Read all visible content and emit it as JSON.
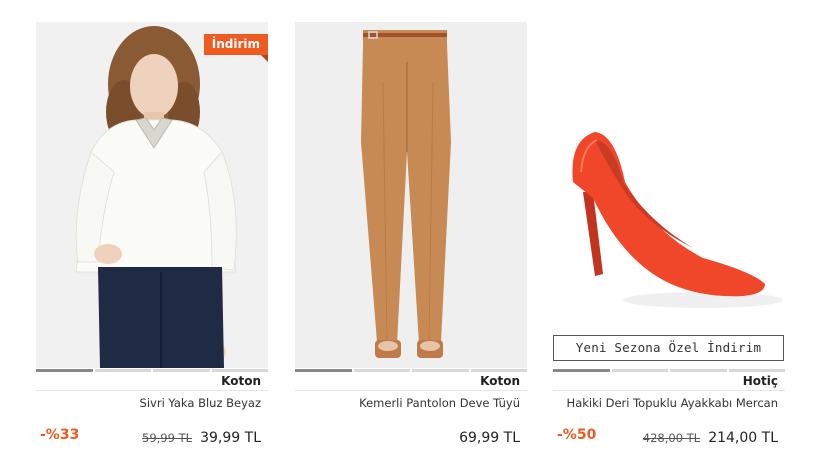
{
  "products": [
    {
      "badge": "İndirim",
      "brand": "Koton",
      "name": "Sivri Yaka Bluz Beyaz",
      "discount": "-%33",
      "old_price": "59,99 TL",
      "price": "39,99 TL"
    },
    {
      "brand": "Koton",
      "name": "Kemerli Pantolon Deve Tüyü",
      "price": "69,99 TL"
    },
    {
      "banner": "Yeni Sezona Özel İndirim",
      "brand": "Hotiç",
      "name": "Hakiki Deri Topuklu Ayakkabı Mercan",
      "discount": "-%50",
      "old_price": "428,00 TL",
      "price": "214,00 TL"
    }
  ],
  "colors": {
    "accent": "#ef5a21",
    "shoe": "#f0462a",
    "pants": "#c88a55",
    "jeans": "#1f2b44"
  },
  "icons": [
    "blouse-image",
    "pants-image",
    "shoe-image"
  ]
}
